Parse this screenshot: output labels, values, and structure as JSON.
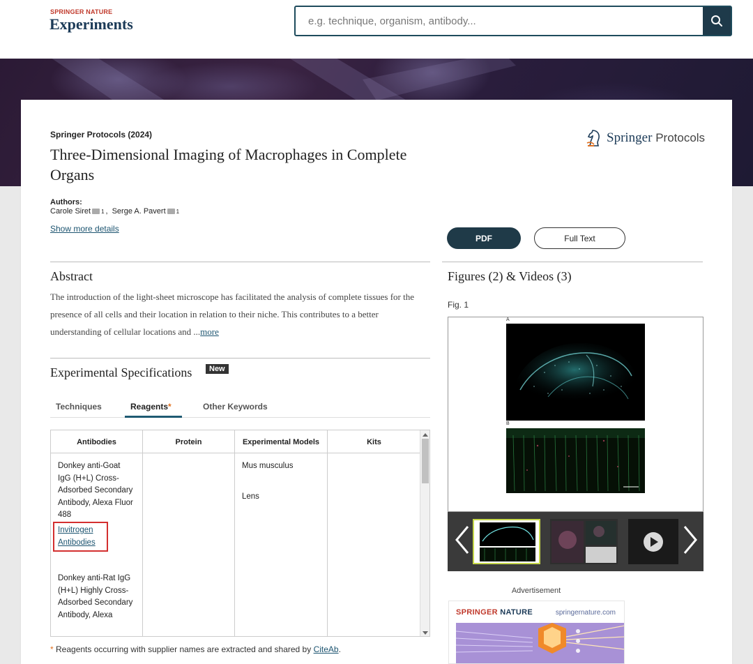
{
  "header": {
    "brand_top": "SPRINGER NATURE",
    "brand_main": "Experiments",
    "search_placeholder": "e.g. technique, organism, antibody..."
  },
  "article": {
    "publication": "Springer Protocols (2024)",
    "title": "Three-Dimensional Imaging of Macrophages in Complete Organs",
    "publisher_logo": {
      "name": "Springer",
      "suffix": "Protocols"
    },
    "authors_label": "Authors:",
    "authors": [
      {
        "name": "Carole Siret",
        "affiliation": "1"
      },
      {
        "name": "Serge A. Pavert",
        "affiliation": "1"
      }
    ],
    "show_more": "Show more details",
    "pdf_label": "PDF",
    "full_text_label": "Full Text"
  },
  "abstract": {
    "heading": "Abstract",
    "text": "The introduction of the light-sheet microscope has facilitated the analysis of complete tissues for the presence of all cells and their location in relation to their niche. This contributes to a better understanding of cellular locations and ...",
    "more": "more"
  },
  "specs": {
    "heading": "Experimental Specifications",
    "badge": "New",
    "tabs": [
      "Techniques",
      "Reagents",
      "Other Keywords"
    ],
    "active_tab": "Reagents",
    "table": {
      "headers": [
        "Antibodies",
        "Protein",
        "Experimental Models",
        "Kits"
      ],
      "antibodies": [
        {
          "name": "Donkey anti-Goat IgG (H+L) Cross-Adsorbed Secondary Antibody, Alexa Fluor 488",
          "supplier": "Invitrogen Antibodies"
        },
        {
          "name": "Donkey anti-Rat IgG (H+L) Highly Cross-Adsorbed Secondary Antibody, Alexa"
        }
      ],
      "models": [
        "Mus musculus",
        "Lens"
      ]
    },
    "footnote_star": "*",
    "footnote_text": "Reagents occurring with supplier names are extracted and shared by",
    "footnote_link": "CiteAb",
    "footnote_end": "."
  },
  "figures": {
    "heading": "Figures (2) & Videos (3)",
    "current_label": "Fig. 1",
    "panel_a": "A",
    "panel_b": "B"
  },
  "ad": {
    "label": "Advertisement",
    "brand": "SPRINGER",
    "brand2": "NATURE",
    "url": "springernature.com"
  },
  "colors": {
    "accent": "#1f3a48",
    "link": "#1c5470",
    "highlight": "#d32f2f",
    "thumb_active": "#c6d84a"
  }
}
